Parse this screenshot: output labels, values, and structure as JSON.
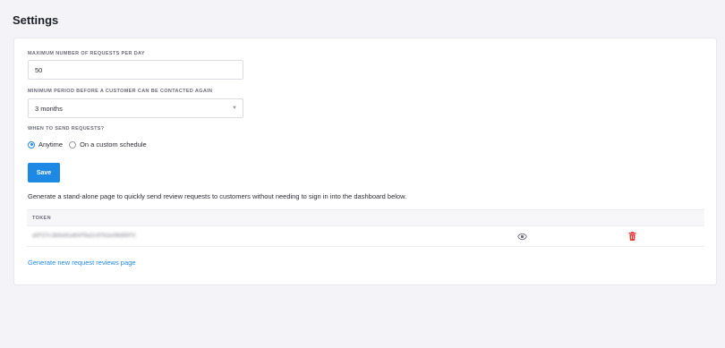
{
  "page": {
    "title": "Settings"
  },
  "settings": {
    "max_requests": {
      "label": "MAXIMUM NUMBER OF REQUESTS PER DAY",
      "value": "50"
    },
    "min_period": {
      "label": "MINIMUM PERIOD BEFORE A CUSTOMER CAN BE CONTACTED AGAIN",
      "selected": "3 months"
    },
    "when_to_send": {
      "label": "WHEN TO SEND REQUESTS?",
      "options": [
        {
          "label": "Anytime",
          "checked": true
        },
        {
          "label": "On a custom schedule",
          "checked": false
        }
      ]
    },
    "save_label": "Save"
  },
  "standalone": {
    "description": "Generate a stand-alone page to quickly send review requests to customers without needing to sign in into the dashboard below.",
    "table": {
      "header": "TOKEN",
      "rows": [
        {
          "token": "a9f27c3b5e81d04f6a2c97b1e38d50f4"
        }
      ]
    },
    "generate_link": "Generate new request reviews page"
  },
  "colors": {
    "accent": "#1e88e5",
    "danger": "#e53935"
  },
  "icons": {
    "view": "eye-icon",
    "delete": "trash-icon",
    "dropdown": "chevron-down-icon"
  }
}
